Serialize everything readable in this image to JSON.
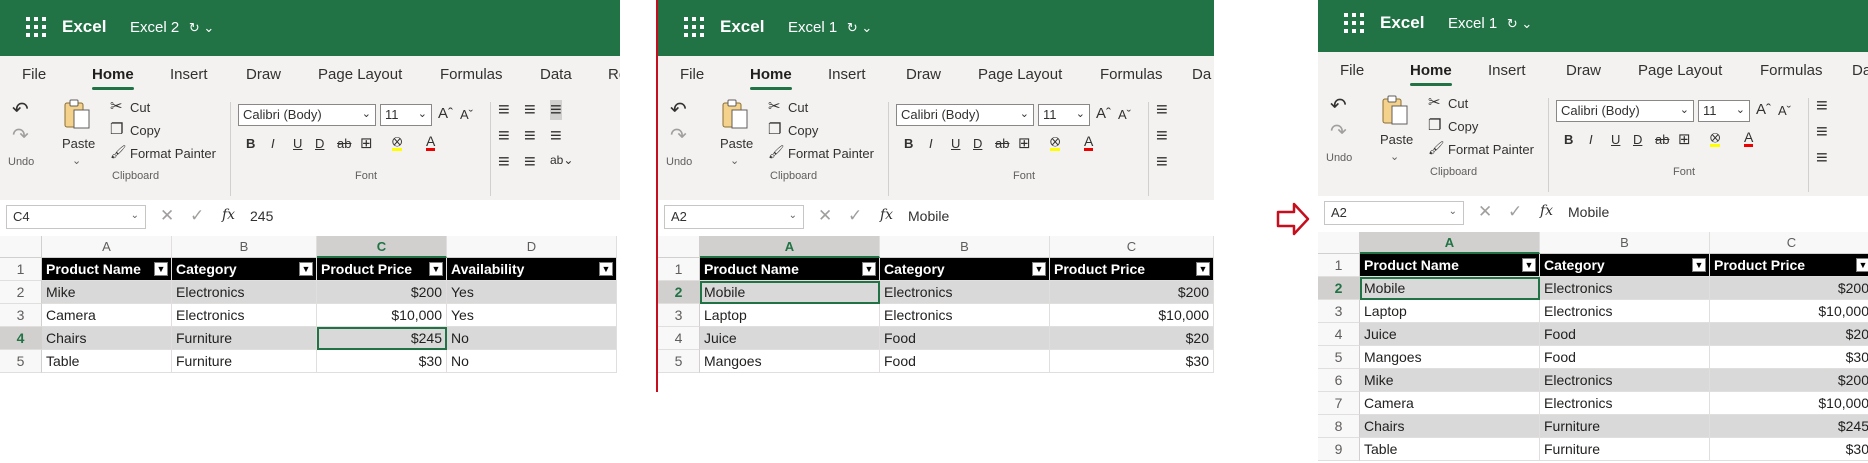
{
  "panels": [
    {
      "app_name": "Excel",
      "doc_name": "Excel 2",
      "menu": [
        "File",
        "Home",
        "Insert",
        "Draw",
        "Page Layout",
        "Formulas",
        "Data",
        "Re"
      ],
      "active_menu": "Home",
      "ribbon": {
        "undo_label": "Undo",
        "paste_label": "Paste",
        "cut_label": "Cut",
        "copy_label": "Copy",
        "format_painter_label": "Format Painter",
        "clipboard_label": "Clipboard",
        "font_name": "Calibri (Body)",
        "font_size": "11",
        "font_label": "Font",
        "bold": "B",
        "italic": "I",
        "underline": "U",
        "double_underline": "D",
        "strike": "ab"
      },
      "name_box": "C4",
      "formula_value": "245",
      "columns": [
        "A",
        "B",
        "C",
        "D"
      ],
      "selected_column": "C",
      "rows": [
        "1",
        "2",
        "3",
        "4",
        "5"
      ],
      "selected_row": "4",
      "headers": [
        "Product Name",
        "Category",
        "Product Price",
        "Availability"
      ],
      "data": [
        [
          "Mike",
          "Electronics",
          "$200",
          "Yes"
        ],
        [
          "Camera",
          "Electronics",
          "$10,000",
          "Yes"
        ],
        [
          "Chairs",
          "Furniture",
          "$245",
          "No"
        ],
        [
          "Table",
          "Furniture",
          "$30",
          "No"
        ]
      ]
    },
    {
      "app_name": "Excel",
      "doc_name": "Excel 1",
      "menu": [
        "File",
        "Home",
        "Insert",
        "Draw",
        "Page Layout",
        "Formulas",
        "Da"
      ],
      "active_menu": "Home",
      "ribbon": {
        "undo_label": "Undo",
        "paste_label": "Paste",
        "cut_label": "Cut",
        "copy_label": "Copy",
        "format_painter_label": "Format Painter",
        "clipboard_label": "Clipboard",
        "font_name": "Calibri (Body)",
        "font_size": "11",
        "font_label": "Font",
        "bold": "B",
        "italic": "I",
        "underline": "U",
        "double_underline": "D",
        "strike": "ab"
      },
      "name_box": "A2",
      "formula_value": "Mobile",
      "columns": [
        "A",
        "B",
        "C"
      ],
      "selected_column": "A",
      "rows": [
        "1",
        "2",
        "3",
        "4",
        "5"
      ],
      "selected_row": "2",
      "headers": [
        "Product Name",
        "Category",
        "Product Price"
      ],
      "data": [
        [
          "Mobile",
          "Electronics",
          "$200"
        ],
        [
          "Laptop",
          "Electronics",
          "$10,000"
        ],
        [
          "Juice",
          "Food",
          "$20"
        ],
        [
          "Mangoes",
          "Food",
          "$30"
        ]
      ]
    },
    {
      "app_name": "Excel",
      "doc_name": "Excel 1",
      "menu": [
        "File",
        "Home",
        "Insert",
        "Draw",
        "Page Layout",
        "Formulas",
        "Da"
      ],
      "active_menu": "Home",
      "ribbon": {
        "undo_label": "Undo",
        "paste_label": "Paste",
        "cut_label": "Cut",
        "copy_label": "Copy",
        "format_painter_label": "Format Painter",
        "clipboard_label": "Clipboard",
        "font_name": "Calibri (Body)",
        "font_size": "11",
        "font_label": "Font",
        "bold": "B",
        "italic": "I",
        "underline": "U",
        "double_underline": "D",
        "strike": "ab"
      },
      "name_box": "A2",
      "formula_value": "Mobile",
      "columns": [
        "A",
        "B",
        "C"
      ],
      "selected_column": "A",
      "rows": [
        "1",
        "2",
        "3",
        "4",
        "5",
        "6",
        "7",
        "8",
        "9"
      ],
      "selected_row": "2",
      "headers": [
        "Product Name",
        "Category",
        "Product Price"
      ],
      "data": [
        [
          "Mobile",
          "Electronics",
          "$200"
        ],
        [
          "Laptop",
          "Electronics",
          "$10,000"
        ],
        [
          "Juice",
          "Food",
          "$20"
        ],
        [
          "Mangoes",
          "Food",
          "$30"
        ],
        [
          "Mike",
          "Electronics",
          "$200"
        ],
        [
          "Camera",
          "Electronics",
          "$10,000"
        ],
        [
          "Chairs",
          "Furniture",
          "$245"
        ],
        [
          "Table",
          "Furniture",
          "$30"
        ]
      ]
    }
  ],
  "colors": {
    "excel_green": "#217346",
    "header_black": "#000000",
    "band_gray": "#d9d9d9",
    "arrow_red": "#c50f1f"
  },
  "icons": {
    "waffle": "app-launcher-icon",
    "undo": "undo-icon",
    "redo": "redo-icon",
    "paste": "paste-icon",
    "cut": "scissors-icon",
    "copy": "copy-icon",
    "format_painter": "brush-icon",
    "filter": "filter-dropdown-icon",
    "arrow": "right-arrow-icon"
  }
}
